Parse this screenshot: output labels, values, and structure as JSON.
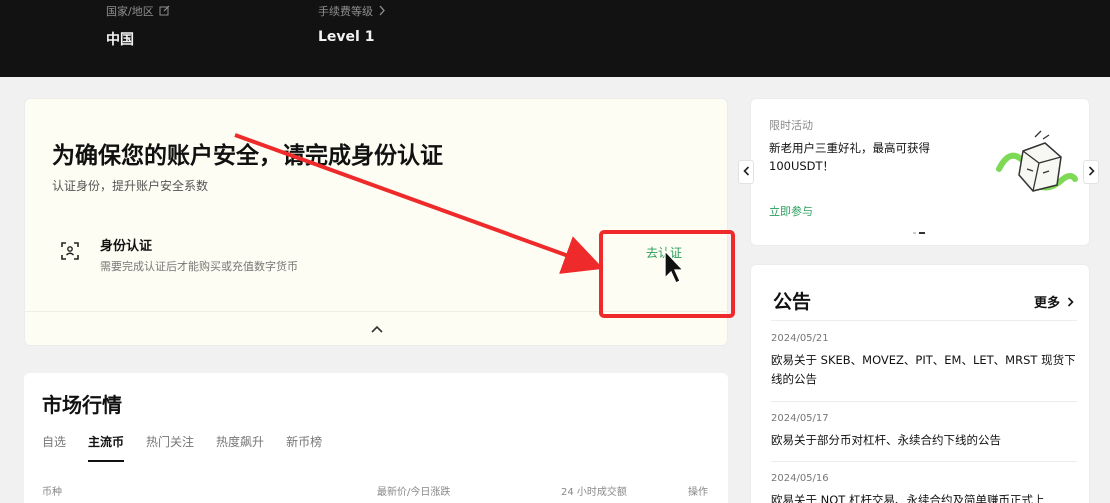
{
  "topbar": {
    "country_label": "国家/地区",
    "country_value": "中国",
    "fee_label": "手续费等级",
    "fee_value": "Level 1"
  },
  "verify": {
    "title": "为确保您的账户安全，请完成身份认证",
    "subtitle": "认证身份，提升账户安全系数",
    "row_title": "身份认证",
    "row_desc": "需要完成认证后才能购买或充值数字货币",
    "action": "去认证"
  },
  "market": {
    "title": "市场行情",
    "tabs": [
      {
        "label": "自选"
      },
      {
        "label": "主流币"
      },
      {
        "label": "热门关注"
      },
      {
        "label": "热度飙升"
      },
      {
        "label": "新币榜"
      }
    ],
    "active_tab": 1,
    "columns": [
      "币种",
      "最新价/今日涨跌",
      "24 小时成交额",
      "操作"
    ]
  },
  "promo": {
    "label": "限时活动",
    "text": "新老用户三重好礼，最高可获得100USDT！",
    "link": "立即参与"
  },
  "notices": {
    "title": "公告",
    "more": "更多",
    "items": [
      {
        "date": "2024/05/21",
        "text": "欧易关于 SKEB、MOVEZ、PIT、EM、LET、MRST 现货下线的公告"
      },
      {
        "date": "2024/05/17",
        "text": "欧易关于部分币对杠杆、永续合约下线的公告"
      },
      {
        "date": "2024/05/16",
        "text": "欧易关于 NOT 杠杆交易、永续合约及简单赚币正式上"
      }
    ]
  },
  "colors": {
    "accent_green": "#2a9d5c",
    "annotation_red": "#ee2a2a",
    "topbar_bg": "#121212"
  }
}
